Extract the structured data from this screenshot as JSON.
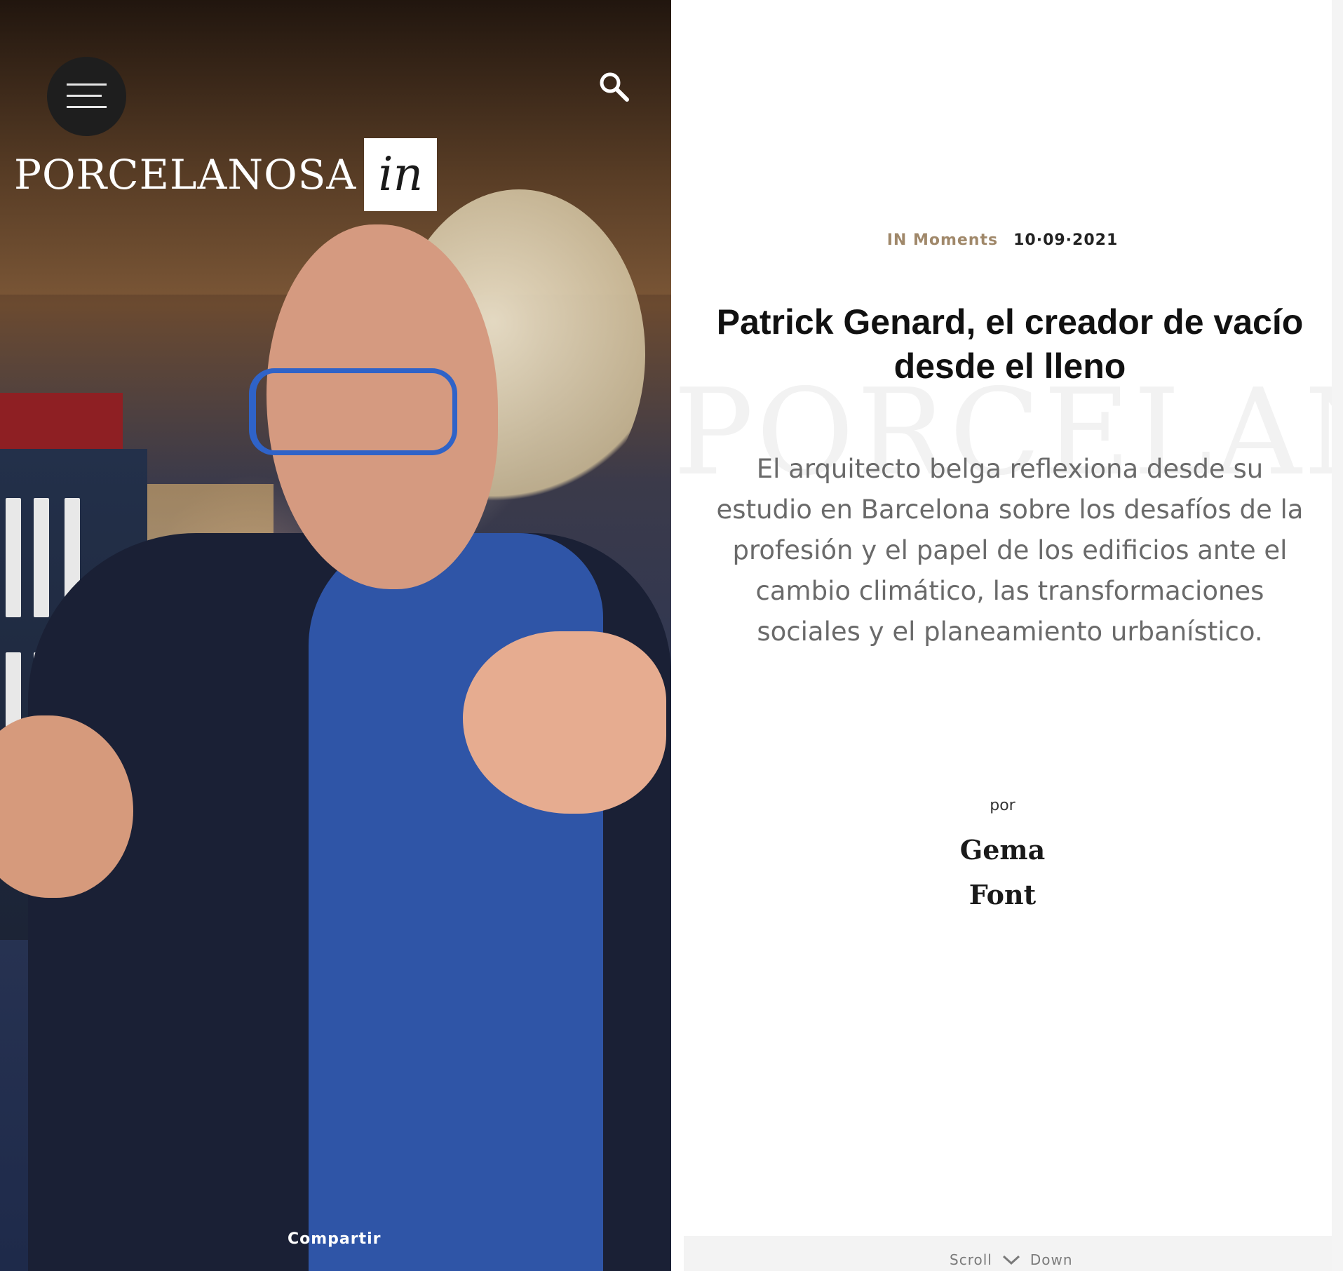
{
  "header": {
    "logo_word": "PORCELANOSA",
    "logo_suffix": "in",
    "menu_icon": "hamburger-icon",
    "search_icon": "search-icon"
  },
  "hero": {
    "share_label": "Compartir"
  },
  "article": {
    "category": "IN Moments",
    "date": "10·09·2021",
    "title": "Patrick Genard, el creador de vacío desde el lleno",
    "subtitle": "El arquitecto belga reflexiona desde su estudio en Barcelona sobre los desafíos de la profesión y el papel de los edificios ante el cambio climático, las transformaciones sociales y el planeamiento urbanístico.",
    "by_label": "por",
    "author_first": "Gema",
    "author_last": "Font",
    "watermark": "PORCELANOSA"
  },
  "scroll": {
    "left": "Scroll",
    "right": "Down",
    "icon": "chevron-down-icon"
  },
  "colors": {
    "accent": "#a0886a",
    "menu_bg": "#1e1e1e"
  }
}
